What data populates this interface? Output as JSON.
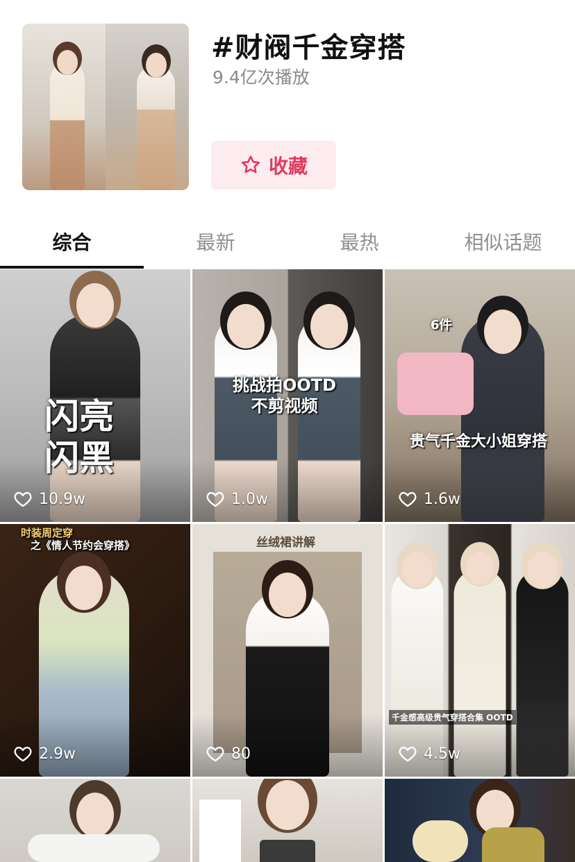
{
  "topic": {
    "title": "#财阀千金穿搭",
    "plays": "9.4亿次播放",
    "favorite_label": "收藏"
  },
  "colors": {
    "accent": "#e23a5c",
    "accent_bg": "#fdecef",
    "text_primary": "#111111",
    "text_secondary": "#8a8a8a"
  },
  "tabs": [
    {
      "label": "综合",
      "active": true
    },
    {
      "label": "最新",
      "active": false
    },
    {
      "label": "最热",
      "active": false
    },
    {
      "label": "相似话题",
      "active": false
    }
  ],
  "videos": [
    {
      "likes": "10.9w",
      "caption": "闪亮\n闪黑",
      "icon": "heart-outline-icon"
    },
    {
      "likes": "1.0w",
      "caption": "挑战拍OOTD\n不剪视频",
      "icon": "heart-outline-icon"
    },
    {
      "likes": "1.6w",
      "caption": "6件\n贵气千金大小姐穿搭",
      "icon": "heart-outline-icon"
    },
    {
      "likes": "2.9w",
      "caption": "时装周定穿\n之《情人节约会穿搭》",
      "icon": "heart-outline-icon"
    },
    {
      "likes": "80",
      "caption": "丝绒裙讲解",
      "icon": "heart-outline-icon"
    },
    {
      "likes": "4.5w",
      "caption": "千金感高级贵气穿搭合集 OOTD",
      "icon": "heart-outline-icon"
    },
    {
      "likes": "",
      "caption": "",
      "icon": "heart-outline-icon"
    },
    {
      "likes": "",
      "caption": "",
      "icon": "heart-outline-icon"
    },
    {
      "likes": "",
      "caption": "",
      "icon": "heart-outline-icon"
    }
  ]
}
